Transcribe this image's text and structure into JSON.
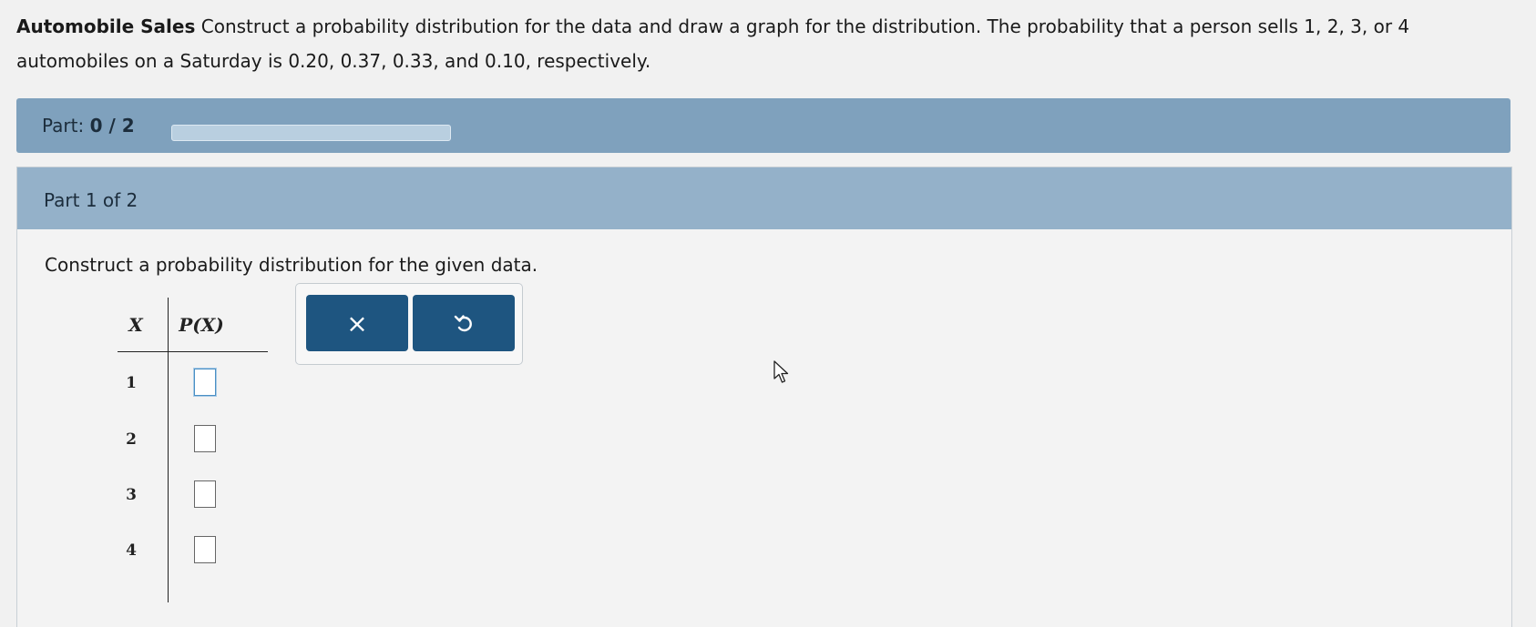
{
  "problem": {
    "title": "Automobile Sales",
    "text": "Construct a probability distribution for the data and draw a graph for the distribution. The probability that a person sells 1, 2, 3, or 4 automobiles on a Saturday is 0.20, 0.37, 0.33, and 0.10, respectively."
  },
  "progress": {
    "label": "Part:",
    "value": "0 / 2",
    "fraction": 0
  },
  "part": {
    "header": "Part 1 of 2",
    "instruction": "Construct a probability distribution for the given data."
  },
  "table": {
    "col_x": "X",
    "col_p": "P(X)",
    "rows": [
      {
        "x": "1",
        "p": ""
      },
      {
        "x": "2",
        "p": ""
      },
      {
        "x": "3",
        "p": ""
      },
      {
        "x": "4",
        "p": ""
      }
    ]
  },
  "tools": {
    "clear_symbol": "×",
    "undo_symbol": "↶",
    "clear_icon": "close-icon",
    "undo_icon": "undo-icon"
  },
  "colors": {
    "progress_bar": "#7fa1bd",
    "part_header": "#94b1c9",
    "button": "#1e5580"
  }
}
